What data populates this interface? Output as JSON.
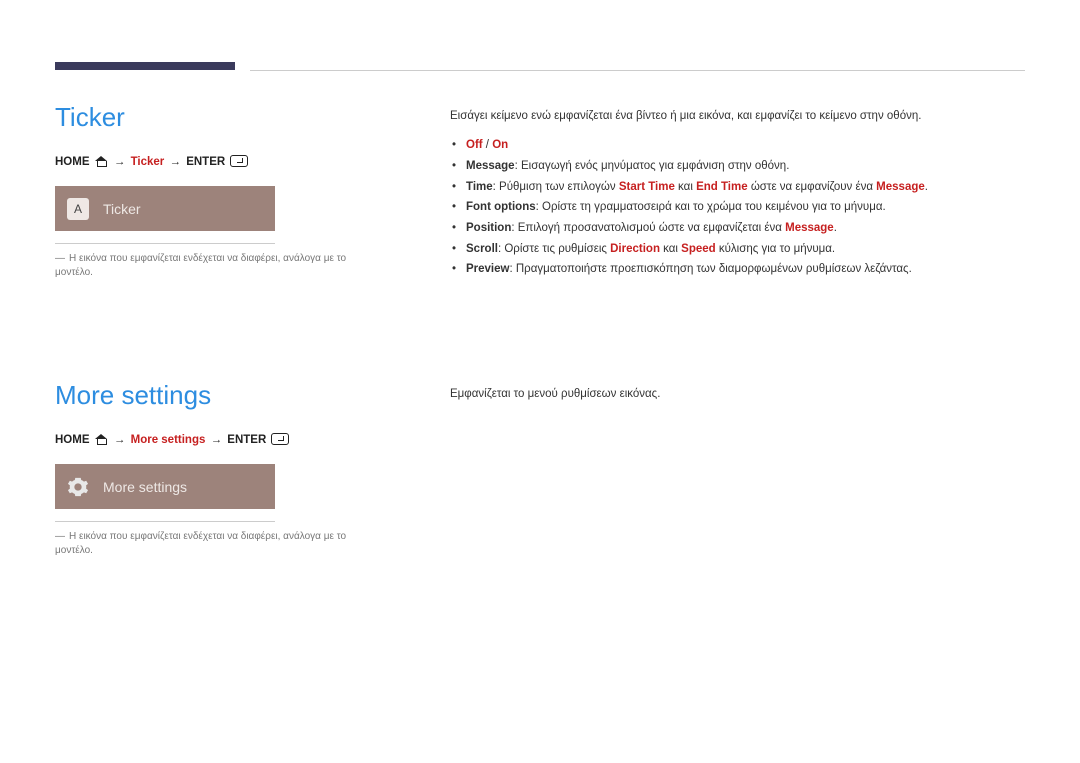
{
  "section1": {
    "title": "Ticker",
    "breadcrumb": {
      "home": "HOME",
      "step_red": "Ticker",
      "enter": "ENTER"
    },
    "preview": {
      "icon_letter": "A",
      "label": "Ticker"
    },
    "disclaimer": "Η εικόνα που εμφανίζεται ενδέχεται να διαφέρει, ανάλογα με το μοντέλο.",
    "intro": "Εισάγει κείμενο ενώ εμφανίζεται ένα βίντεο ή μια εικόνα, και εμφανίζει το κείμενο στην οθόνη.",
    "b1_off": "Off",
    "b1_sep": " / ",
    "b1_on": "On",
    "b2_k": "Message",
    "b2_t": ": Εισαγωγή ενός μηνύματος για εμφάνιση στην οθόνη.",
    "b3_k": "Time",
    "b3_t1": ": Ρύθμιση των επιλογών ",
    "b3_s1": "Start Time",
    "b3_t2": " και ",
    "b3_s2": "End Time",
    "b3_t3": " ώστε να εμφανίζουν ένα ",
    "b3_s3": "Message",
    "b3_t4": ".",
    "b4_k": "Font options",
    "b4_t": ": Ορίστε τη γραμματοσειρά και το χρώμα του κειμένου για το μήνυμα.",
    "b5_k": "Position",
    "b5_t1": ": Επιλογή προσανατολισμού ώστε να εμφανίζεται ένα ",
    "b5_s1": "Message",
    "b5_t2": ".",
    "b6_k": "Scroll",
    "b6_t1": ": Ορίστε τις ρυθμίσεις ",
    "b6_s1": "Direction",
    "b6_t2": " και ",
    "b6_s2": "Speed",
    "b6_t3": " κύλισης για το μήνυμα.",
    "b7_k": "Preview",
    "b7_t": ": Πραγματοποιήστε προεπισκόπηση των διαμορφωμένων ρυθμίσεων λεζάντας."
  },
  "section2": {
    "title": "More settings",
    "breadcrumb": {
      "home": "HOME",
      "step_red": "More settings",
      "enter": "ENTER"
    },
    "preview": {
      "label": "More settings"
    },
    "disclaimer": "Η εικόνα που εμφανίζεται ενδέχεται να διαφέρει, ανάλογα με το μοντέλο.",
    "intro": "Εμφανίζεται το μενού ρυθμίσεων εικόνας."
  }
}
